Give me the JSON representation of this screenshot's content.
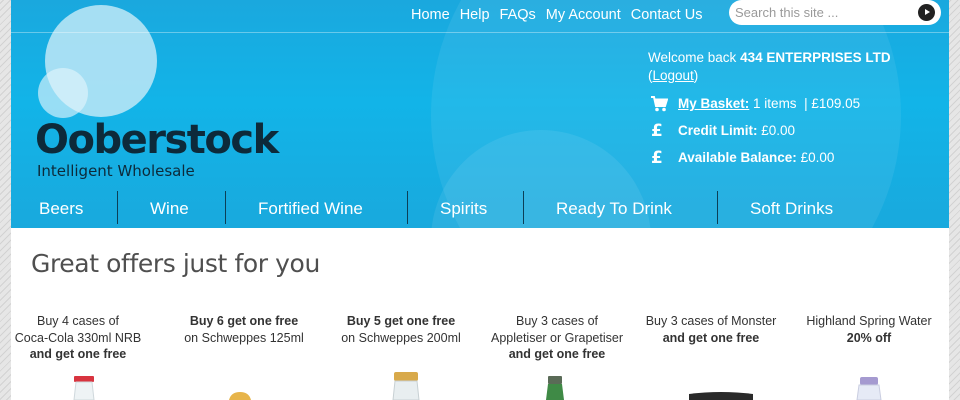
{
  "header": {
    "logo_name": "Ooberstock",
    "logo_tagline": "Intelligent Wholesale",
    "top_links": [
      "Home",
      "Help",
      "FAQs",
      "My Account",
      "Contact Us"
    ],
    "search": {
      "placeholder": "Search this site ...",
      "value": ""
    },
    "account": {
      "welcome_prefix": "Welcome back",
      "company": "434 ENTERPRISES LTD",
      "logout_open": "(",
      "logout_label": "Logout",
      "logout_close": ")",
      "basket_label": "My Basket:",
      "basket_items": "1 items",
      "basket_sep": "|",
      "basket_total": "£109.05",
      "credit_label": "Credit Limit:",
      "credit_value": "£0.00",
      "balance_label": "Available Balance:",
      "balance_value": "£0.00",
      "basket_icon": "cart-icon",
      "credit_icon": "pound-icon",
      "balance_icon": "pound-icon",
      "pound_glyph": "£"
    },
    "nav": [
      "Beers",
      "Wine",
      "Fortified Wine",
      "Spirits",
      "Ready To Drink",
      "Soft Drinks"
    ]
  },
  "main": {
    "title": "Great offers just for you",
    "offers": [
      {
        "line1": "Buy 4 cases of",
        "line2": "Coca-Cola 330ml NRB",
        "line3": "and get one free"
      },
      {
        "line1": "Buy 6 get one free",
        "line2": "on Schweppes 125ml"
      },
      {
        "line1": "Buy 5 get one free",
        "line2": "on Schweppes 200ml"
      },
      {
        "line1": "Buy 3 cases of",
        "line2": "Appletiser or Grapetiser",
        "line3": "and get one free"
      },
      {
        "line1": "Buy 3 cases of Monster",
        "line2": "and get one free"
      },
      {
        "line1": "Highland Spring Water",
        "line2": "20% off"
      }
    ]
  },
  "colors": {
    "header_blue": "#12b4e8",
    "logo_dark": "#0d2a3a",
    "nav_separator": "#0b3f57",
    "title_grey": "#4f4f4f"
  }
}
